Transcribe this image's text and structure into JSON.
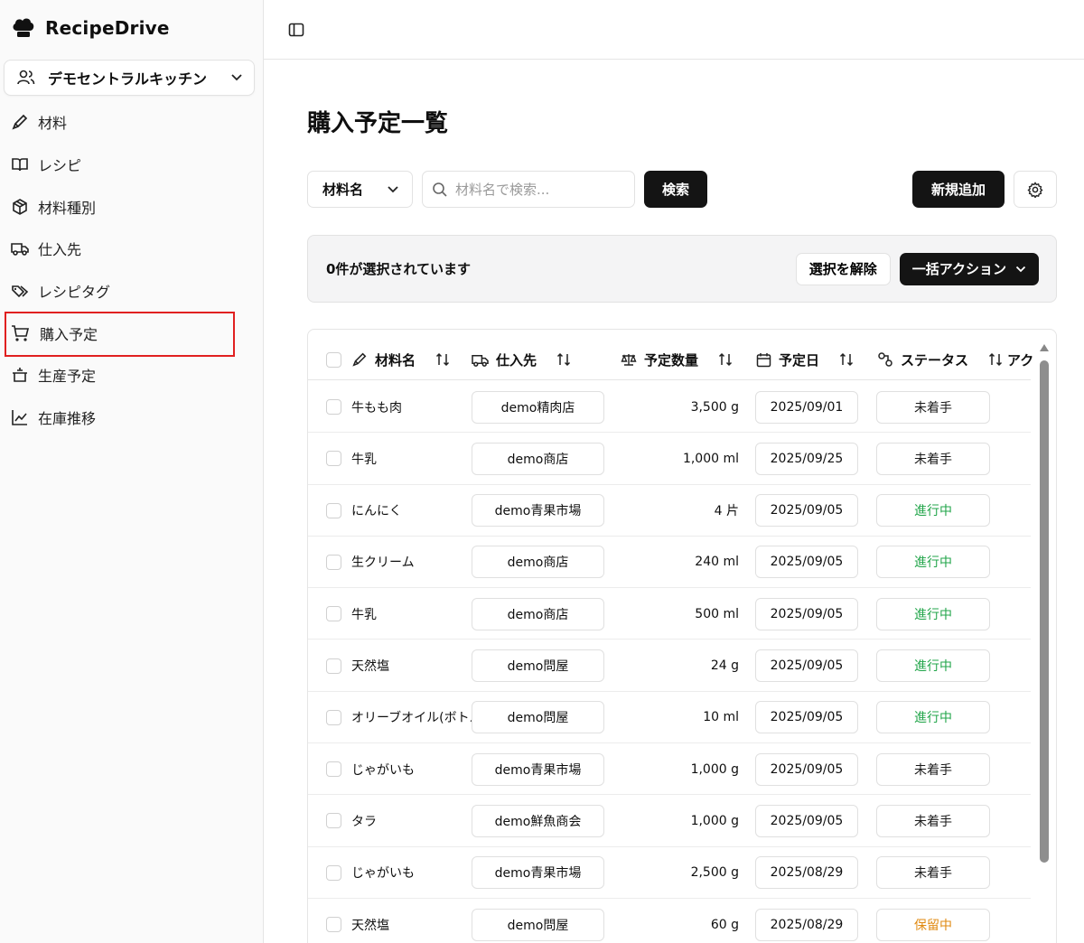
{
  "app": {
    "name": "RecipeDrive"
  },
  "org": {
    "name": "デモセントラルキッチン"
  },
  "sidebar": {
    "items": [
      {
        "label": "材料",
        "icon": "pencil-icon"
      },
      {
        "label": "レシピ",
        "icon": "book-icon"
      },
      {
        "label": "材料種別",
        "icon": "box-icon"
      },
      {
        "label": "仕入先",
        "icon": "truck-icon"
      },
      {
        "label": "レシピタグ",
        "icon": "tags-icon"
      },
      {
        "label": "購入予定",
        "icon": "cart-icon",
        "active": true
      },
      {
        "label": "生産予定",
        "icon": "pot-icon"
      },
      {
        "label": "在庫推移",
        "icon": "chart-icon"
      }
    ]
  },
  "page": {
    "title": "購入予定一覧"
  },
  "filter": {
    "field": "材料名",
    "search_placeholder": "材料名で検索...",
    "search_value": "",
    "search_button": "検索",
    "new_button": "新規追加"
  },
  "selection": {
    "text": "0件が選択されています",
    "clear_button": "選択を解除",
    "bulk_button": "一括アクション"
  },
  "table": {
    "columns": [
      "材料名",
      "仕入先",
      "予定数量",
      "予定日",
      "ステータス",
      "アク"
    ],
    "rows": [
      {
        "name": "牛もも肉",
        "supplier": "demo精肉店",
        "qty": "3,500 g",
        "date": "2025/09/01",
        "status": "未着手",
        "status_type": "notstarted"
      },
      {
        "name": "牛乳",
        "supplier": "demo商店",
        "qty": "1,000 ml",
        "date": "2025/09/25",
        "status": "未着手",
        "status_type": "notstarted"
      },
      {
        "name": "にんにく",
        "supplier": "demo青果市場",
        "qty": "4 片",
        "date": "2025/09/05",
        "status": "進行中",
        "status_type": "inprogress"
      },
      {
        "name": "生クリーム",
        "supplier": "demo商店",
        "qty": "240 ml",
        "date": "2025/09/05",
        "status": "進行中",
        "status_type": "inprogress"
      },
      {
        "name": "牛乳",
        "supplier": "demo商店",
        "qty": "500 ml",
        "date": "2025/09/05",
        "status": "進行中",
        "status_type": "inprogress"
      },
      {
        "name": "天然塩",
        "supplier": "demo問屋",
        "qty": "24 g",
        "date": "2025/09/05",
        "status": "進行中",
        "status_type": "inprogress"
      },
      {
        "name": "オリーブオイル(ボトル)",
        "supplier": "demo問屋",
        "qty": "10 ml",
        "date": "2025/09/05",
        "status": "進行中",
        "status_type": "inprogress"
      },
      {
        "name": "じゃがいも",
        "supplier": "demo青果市場",
        "qty": "1,000 g",
        "date": "2025/09/05",
        "status": "未着手",
        "status_type": "notstarted"
      },
      {
        "name": "タラ",
        "supplier": "demo鮮魚商会",
        "qty": "1,000 g",
        "date": "2025/09/05",
        "status": "未着手",
        "status_type": "notstarted"
      },
      {
        "name": "じゃがいも",
        "supplier": "demo青果市場",
        "qty": "2,500 g",
        "date": "2025/08/29",
        "status": "未着手",
        "status_type": "notstarted"
      },
      {
        "name": "天然塩",
        "supplier": "demo問屋",
        "qty": "60 g",
        "date": "2025/08/29",
        "status": "保留中",
        "status_type": "onhold"
      }
    ]
  },
  "colors": {
    "accent_dark": "#141414",
    "status_inprogress": "#22a54a",
    "status_onhold": "#e08a12",
    "highlight_box": "#e02020"
  }
}
